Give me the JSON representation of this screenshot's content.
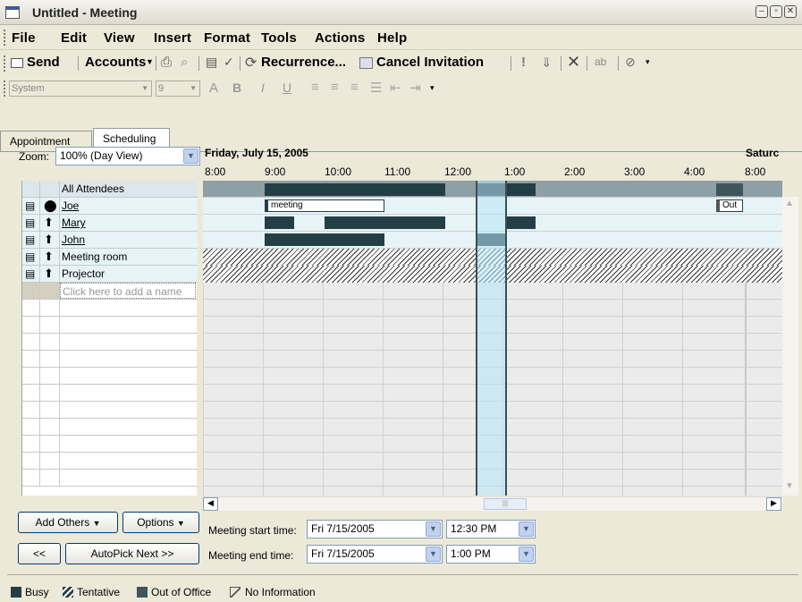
{
  "window": {
    "title": "Untitled - Meeting"
  },
  "menu": [
    "File",
    "Edit",
    "View",
    "Insert",
    "Format",
    "Tools",
    "Actions",
    "Help"
  ],
  "toolbar": {
    "send": "Send",
    "accounts": "Accounts",
    "recurrence": "Recurrence...",
    "cancel_invitation": "Cancel Invitation"
  },
  "format_toolbar": {
    "style": "System",
    "size": "9"
  },
  "tabs": [
    "Appointment",
    "Scheduling"
  ],
  "zoom": {
    "label": "Zoom:",
    "value": "100% (Day View)"
  },
  "schedule": {
    "date_header": "Friday, July 15, 2005",
    "next_day_header": "Saturc",
    "times": [
      "8:00",
      "9:00",
      "10:00",
      "11:00",
      "12:00",
      "1:00",
      "2:00",
      "3:00",
      "4:00",
      "8:00"
    ]
  },
  "attendees": {
    "header": "All Attendees",
    "rows": [
      "Joe",
      "Mary",
      "John",
      "Meeting room",
      "Projector"
    ],
    "add_placeholder": "Click here to add a name"
  },
  "busy_labels": {
    "joe_meeting": "meeting",
    "joe_out": "Out"
  },
  "buttons": {
    "add_others": "Add Others",
    "options": "Options",
    "prev": "<<",
    "autopick": "AutoPick Next >>"
  },
  "meeting_times": {
    "start_label": "Meeting start time:",
    "end_label": "Meeting end time:",
    "start_date": "Fri 7/15/2005",
    "start_time": "12:30 PM",
    "end_date": "Fri 7/15/2005",
    "end_time": "1:00 PM"
  },
  "legend": [
    "Busy",
    "Tentative",
    "Out of Office",
    "No Information"
  ]
}
